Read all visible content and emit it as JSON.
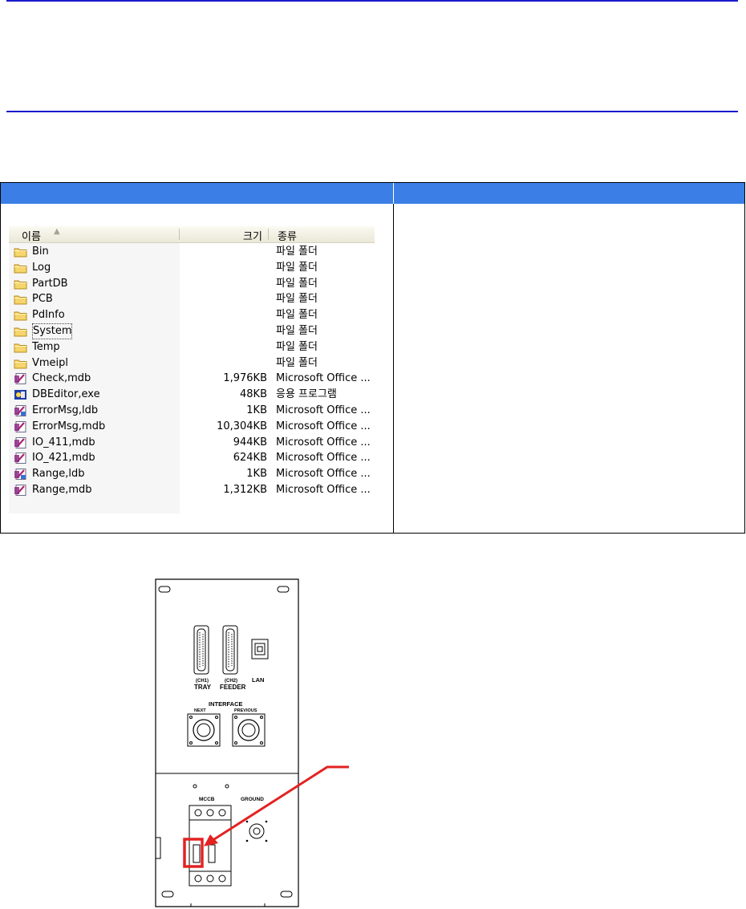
{
  "explorer": {
    "headers": {
      "name": "이름",
      "sort_arrow": "▲",
      "size": "크기",
      "type": "종류"
    },
    "rows": [
      {
        "name": "Bin",
        "size": "",
        "type": "파일 폴더",
        "icon": "folder-icon"
      },
      {
        "name": "Log",
        "size": "",
        "type": "파일 폴더",
        "icon": "folder-icon"
      },
      {
        "name": "PartDB",
        "size": "",
        "type": "파일 폴더",
        "icon": "folder-icon"
      },
      {
        "name": "PCB",
        "size": "",
        "type": "파일 폴더",
        "icon": "folder-icon"
      },
      {
        "name": "PdInfo",
        "size": "",
        "type": "파일 폴더",
        "icon": "folder-icon"
      },
      {
        "name": "System",
        "size": "",
        "type": "파일 폴더",
        "icon": "folder-icon"
      },
      {
        "name": "Temp",
        "size": "",
        "type": "파일 폴더",
        "icon": "folder-icon"
      },
      {
        "name": "Vmeipl",
        "size": "",
        "type": "파일 폴더",
        "icon": "folder-icon"
      },
      {
        "name": "Check,mdb",
        "size": "1,976KB",
        "type": "Microsoft Office ...",
        "icon": "access-db-icon"
      },
      {
        "name": "DBEditor,exe",
        "size": "48KB",
        "type": "응용 프로그램",
        "icon": "app-exe-icon"
      },
      {
        "name": "ErrorMsg,ldb",
        "size": "1KB",
        "type": "Microsoft Office ...",
        "icon": "access-lock-icon"
      },
      {
        "name": "ErrorMsg,mdb",
        "size": "10,304KB",
        "type": "Microsoft Office ...",
        "icon": "access-db-icon"
      },
      {
        "name": "IO_411,mdb",
        "size": "944KB",
        "type": "Microsoft Office ...",
        "icon": "access-db-icon"
      },
      {
        "name": "IO_421,mdb",
        "size": "624KB",
        "type": "Microsoft Office ...",
        "icon": "access-db-icon"
      },
      {
        "name": "Range,ldb",
        "size": "1KB",
        "type": "Microsoft Office ...",
        "icon": "access-lock-icon"
      },
      {
        "name": "Range,mdb",
        "size": "1,312KB",
        "type": "Microsoft Office ...",
        "icon": "access-db-icon"
      }
    ]
  },
  "panel": {
    "ch1_line1": "(CH1)",
    "ch1_line2": "TRAY",
    "ch2_line1": "(CH2)",
    "ch2_line2": "FEEDER",
    "lan": "LAN",
    "interface": "INTERFACE",
    "next": "NEXT",
    "previous": "PREVIOUS",
    "mccb": "MCCB",
    "ground": "GROUND"
  },
  "colors": {
    "rule": "#1a1acd",
    "table_header": "#3a7ee6",
    "callout": "#e32222"
  }
}
